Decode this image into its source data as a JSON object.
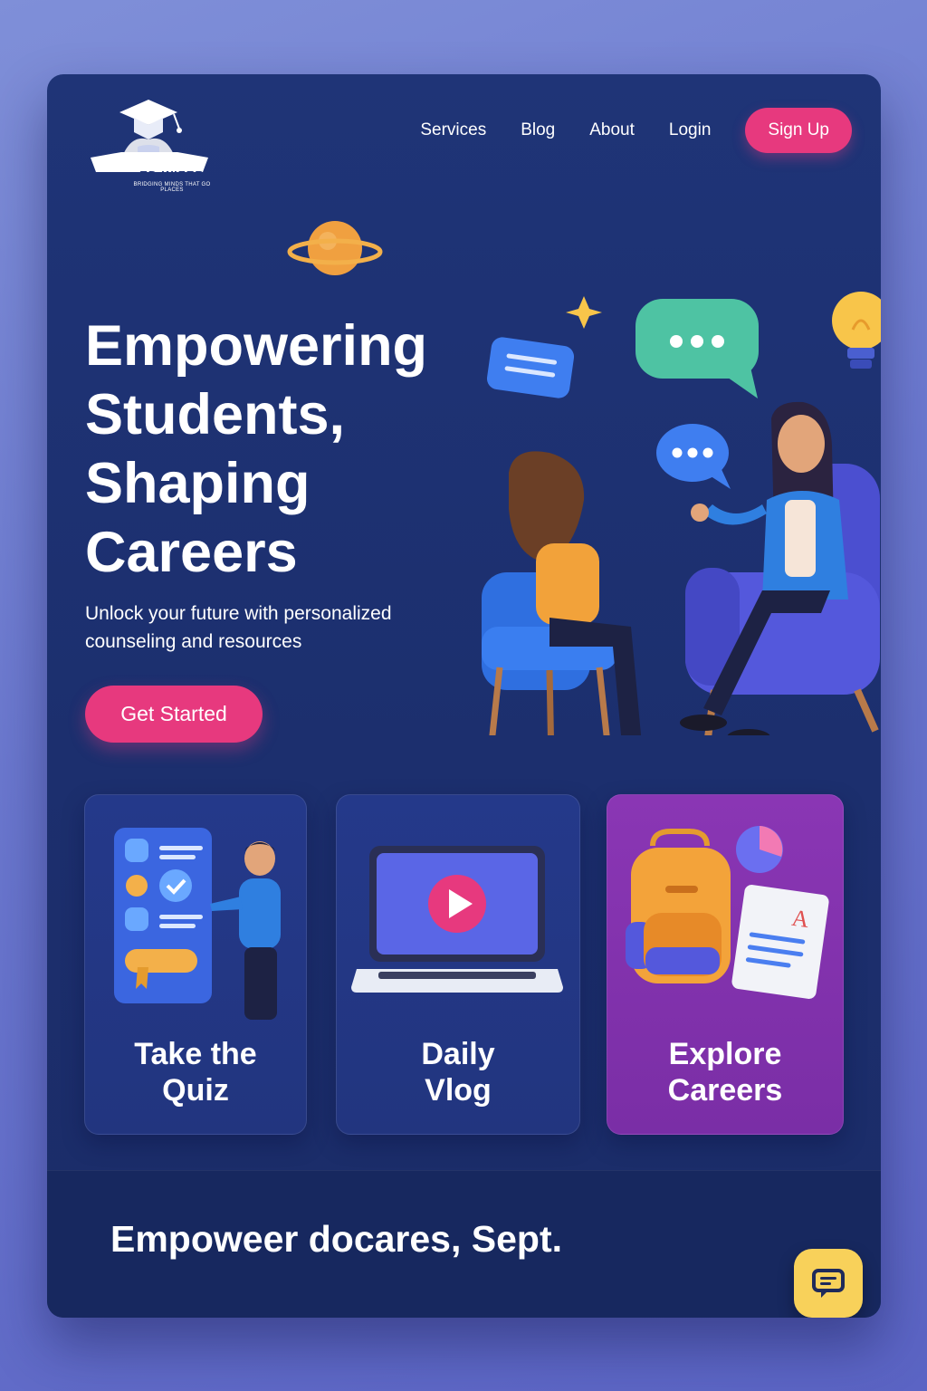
{
  "brand": {
    "name": "ED WIZER",
    "tagline": "BRIDGING MINDS THAT GO PLACES"
  },
  "nav": {
    "links": [
      "Services",
      "Blog",
      "About",
      "Login"
    ],
    "signup_label": "Sign Up"
  },
  "hero": {
    "title_lines": [
      "Empowering",
      "Students,",
      "Shaping",
      "Careers"
    ],
    "subtitle_lines": [
      "Unlock your future with personalized",
      "counseling and resources"
    ],
    "cta_label": "Get Started"
  },
  "features": [
    {
      "label_lines": [
        "Take the",
        "Quiz"
      ],
      "icon": "quiz-board-icon"
    },
    {
      "label_lines": [
        "Daily",
        "Vlog"
      ],
      "icon": "laptop-play-icon"
    },
    {
      "label_lines": [
        "Explore",
        "Careers"
      ],
      "icon": "backpack-resume-icon"
    }
  ],
  "footer": {
    "text": "Empoweer docares, Sept.",
    "chat_icon": "chat-bubble-icon"
  },
  "colors": {
    "background": "#6b78cf",
    "card": "#1f3477",
    "accent_pink": "#e7397e",
    "explore_purple": "#8a36b4",
    "chat_yellow": "#f8d15a"
  }
}
